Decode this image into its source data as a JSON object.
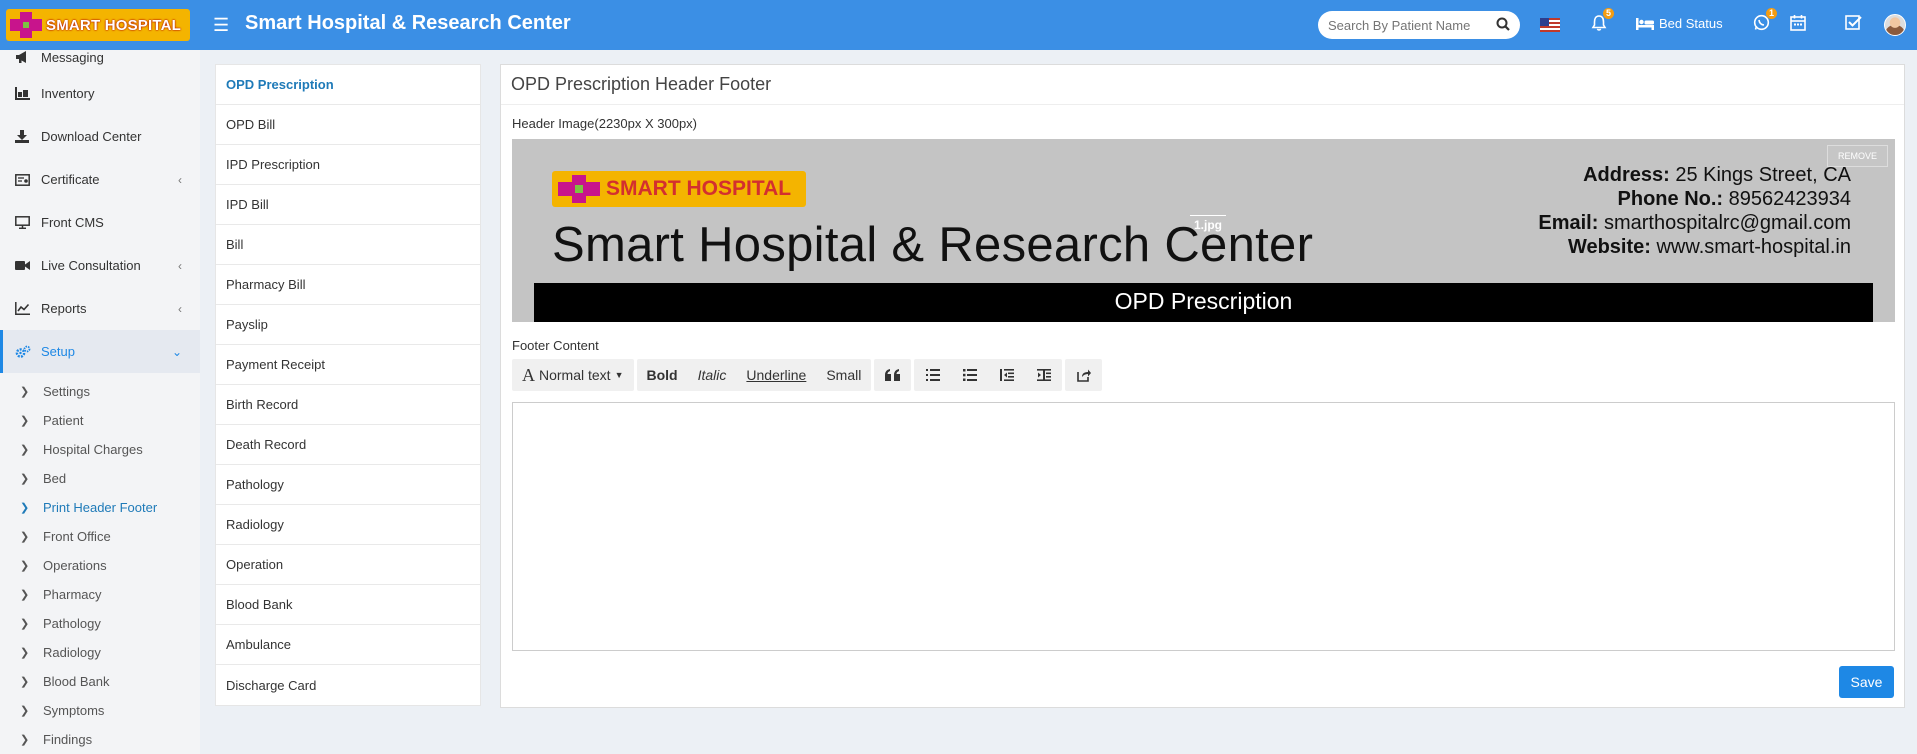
{
  "topbar": {
    "logo_text": "SMART HOSPITAL",
    "app_title": "Smart Hospital & Research Center",
    "search_placeholder": "Search By Patient Name",
    "notification_count": "5",
    "whatsapp_count": "1",
    "bed_status": "Bed Status"
  },
  "sidebar": {
    "items": [
      {
        "label": "Messaging",
        "icon": "bullhorn-icon"
      },
      {
        "label": "Inventory",
        "icon": "inventory-icon"
      },
      {
        "label": "Download Center",
        "icon": "download-icon"
      },
      {
        "label": "Certificate",
        "icon": "certificate-icon"
      },
      {
        "label": "Front CMS",
        "icon": "monitor-icon"
      },
      {
        "label": "Live Consultation",
        "icon": "video-icon"
      },
      {
        "label": "Reports",
        "icon": "line-chart-icon"
      },
      {
        "label": "Setup",
        "icon": "gears-icon"
      }
    ],
    "sub_items": [
      "Settings",
      "Patient",
      "Hospital Charges",
      "Bed",
      "Print Header Footer",
      "Front Office",
      "Operations",
      "Pharmacy",
      "Pathology",
      "Radiology",
      "Blood Bank",
      "Symptoms",
      "Findings"
    ]
  },
  "menu": {
    "items": [
      "OPD Prescription",
      "OPD Bill",
      "IPD Prescription",
      "IPD Bill",
      "Bill",
      "Pharmacy Bill",
      "Payslip",
      "Payment Receipt",
      "Birth Record",
      "Death Record",
      "Pathology",
      "Radiology",
      "Operation",
      "Blood Bank",
      "Ambulance",
      "Discharge Card"
    ]
  },
  "panel": {
    "title": "OPD Prescription Header Footer",
    "header_image_label": "Header Image(2230px X 300px)",
    "header_image": {
      "logo_text": "SMART HOSPITAL",
      "title": "Smart Hospital & Research Center",
      "address_label": "Address:",
      "address": "25 Kings Street, CA",
      "phone_label": "Phone No.:",
      "phone": "89562423934",
      "email_label": "Email:",
      "email": "smarthospitalrc@gmail.com",
      "website_label": "Website:",
      "website": "www.smart-hospital.in",
      "bar_text": "OPD Prescription",
      "file_name": "1.jpg",
      "remove": "REMOVE"
    },
    "footer_label": "Footer Content",
    "toolbar": {
      "normal_text": "Normal text",
      "bold": "Bold",
      "italic": "Italic",
      "underline": "Underline",
      "small": "Small"
    },
    "save": "Save"
  },
  "colors": {
    "topbar": "#3b8fe5",
    "accent": "#1e88e5",
    "logo_bg": "#f4b400"
  }
}
